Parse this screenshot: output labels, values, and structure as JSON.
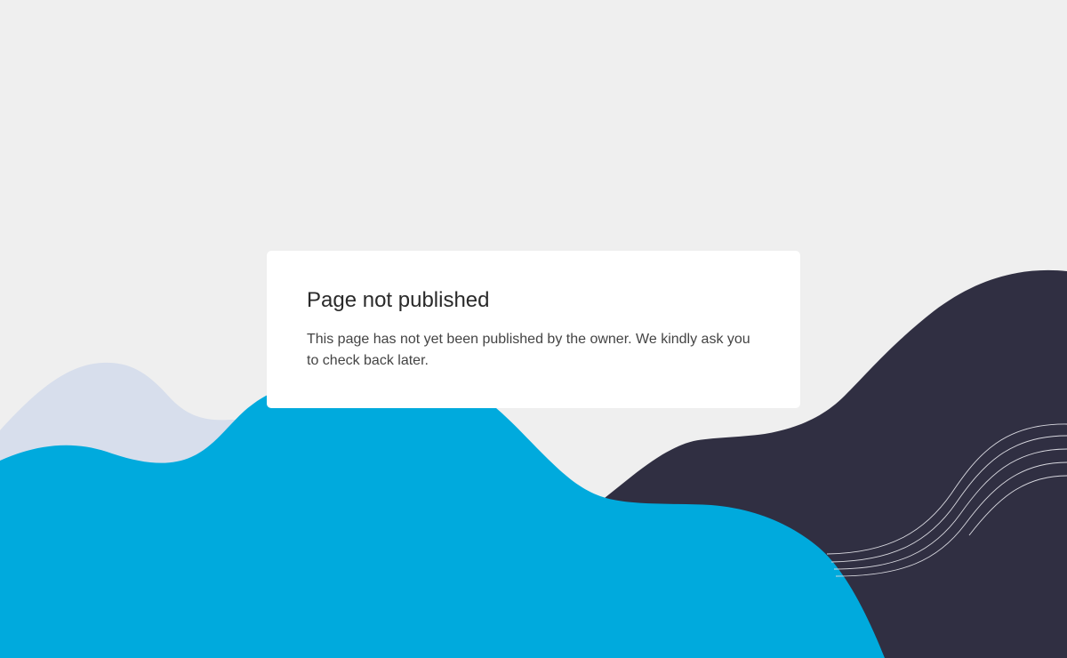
{
  "notice": {
    "title": "Page not published",
    "message": "This page has not yet been published by the owner. We kindly ask you to check back later."
  },
  "colors": {
    "background": "#efefef",
    "light_wave": "#d7deec",
    "blue_wave": "#00aadd",
    "dark_wave": "#302f42",
    "line_pattern": "#d9d9e0"
  }
}
